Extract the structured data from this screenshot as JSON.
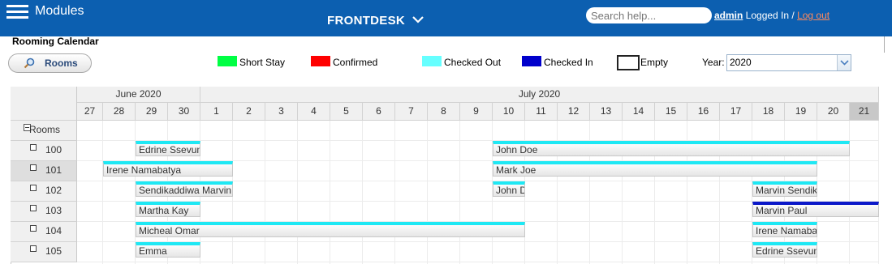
{
  "header": {
    "modules_label": "Modules",
    "app_title": "FRONTDESK",
    "search_placeholder": "Search help...",
    "user": "admin",
    "logged_in_text": " Logged In / ",
    "logout": "Log out"
  },
  "page": {
    "title": "Rooming Calendar",
    "rooms_button": "Rooms"
  },
  "legend": [
    {
      "label": "Short Stay",
      "color": "#00ff44"
    },
    {
      "label": "Confirmed",
      "color": "#ff0000"
    },
    {
      "label": "Checked Out",
      "color": "#66ffff"
    },
    {
      "label": "Checked In",
      "color": "#0000cc"
    },
    {
      "label": "Empty",
      "color": "#ffffff"
    }
  ],
  "year": {
    "label": "Year:",
    "selected": "2020"
  },
  "calendar": {
    "months": [
      "June 2020",
      "July 2020"
    ],
    "days": [
      "27",
      "28",
      "29",
      "30",
      "1",
      "2",
      "3",
      "4",
      "5",
      "6",
      "7",
      "8",
      "9",
      "10",
      "11",
      "12",
      "13",
      "14",
      "15",
      "16",
      "17",
      "18",
      "19",
      "20",
      "21"
    ],
    "today_index": 24,
    "group_label": "Rooms",
    "rooms": [
      "100",
      "101",
      "102",
      "103",
      "104",
      "105"
    ],
    "selected_room": "101",
    "colors": {
      "checked_out": "#1ee8f4",
      "checked_in": "#0b18c9"
    },
    "bookings": [
      {
        "room": 0,
        "start": 2,
        "end": 4,
        "guest": "Edrine Ssevume",
        "status": "checked_out"
      },
      {
        "room": 0,
        "start": 13,
        "end": 24,
        "guest": "John Doe",
        "status": "checked_out"
      },
      {
        "room": 1,
        "start": 1,
        "end": 5,
        "guest": "Irene Namabatya",
        "status": "checked_out"
      },
      {
        "room": 1,
        "start": 13,
        "end": 23,
        "guest": "Mark Joe",
        "status": "checked_out"
      },
      {
        "room": 2,
        "start": 2,
        "end": 5,
        "guest": "Sendikaddiwa Marvin",
        "status": "checked_out"
      },
      {
        "room": 2,
        "start": 13,
        "end": 14,
        "guest": "John Doe",
        "status": "checked_out"
      },
      {
        "room": 2,
        "start": 21,
        "end": 23,
        "guest": "Marvin Sendikaddiwa",
        "status": "checked_out"
      },
      {
        "room": 3,
        "start": 2,
        "end": 4,
        "guest": "Martha Kay",
        "status": "checked_out"
      },
      {
        "room": 3,
        "start": 21,
        "end": 25,
        "guest": "Marvin Paul",
        "status": "checked_in"
      },
      {
        "room": 4,
        "start": 2,
        "end": 14,
        "guest": "Micheal Omar",
        "status": "checked_out"
      },
      {
        "room": 4,
        "start": 21,
        "end": 23,
        "guest": "Irene Namabatya",
        "status": "checked_out"
      },
      {
        "room": 5,
        "start": 2,
        "end": 4,
        "guest": "Emma",
        "status": "checked_out"
      },
      {
        "room": 5,
        "start": 21,
        "end": 23,
        "guest": "Edrine Ssevume",
        "status": "checked_out"
      }
    ]
  }
}
